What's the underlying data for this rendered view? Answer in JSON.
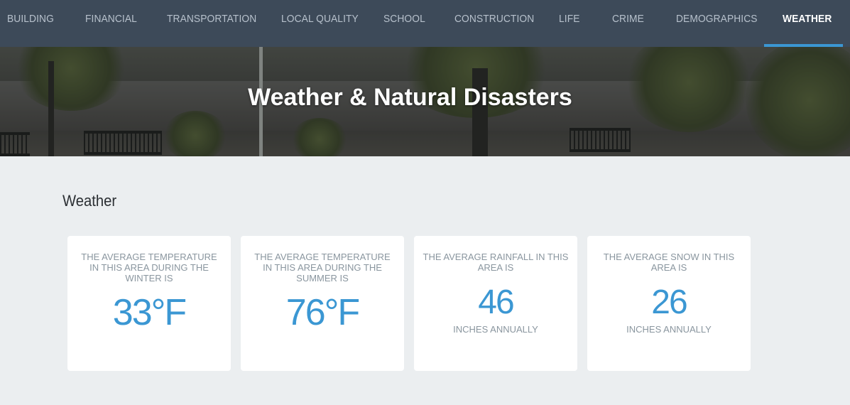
{
  "nav": {
    "items": [
      {
        "label": "BUILDING"
      },
      {
        "label": "FINANCIAL"
      },
      {
        "label": "TRANSPORTATION"
      },
      {
        "label": "LOCAL QUALITY"
      },
      {
        "label": "SCHOOL"
      },
      {
        "label": "CONSTRUCTION"
      },
      {
        "label": "LIFE"
      },
      {
        "label": "CRIME"
      },
      {
        "label": "DEMOGRAPHICS"
      },
      {
        "label": "WEATHER"
      }
    ],
    "active": "WEATHER"
  },
  "hero": {
    "title": "Weather & Natural Disasters"
  },
  "weather": {
    "section_title": "Weather",
    "cards": [
      {
        "label": "THE AVERAGE TEMPERATURE IN THIS AREA DURING THE WINTER IS",
        "value": "33°F",
        "unit": ""
      },
      {
        "label": "THE AVERAGE TEMPERATURE IN THIS AREA DURING THE SUMMER IS",
        "value": "76°F",
        "unit": ""
      },
      {
        "label": "THE AVERAGE RAINFALL IN THIS AREA IS",
        "value": "46",
        "unit": "INCHES ANNUALLY"
      },
      {
        "label": "THE AVERAGE SNOW IN THIS AREA IS",
        "value": "26",
        "unit": "INCHES ANNUALLY"
      }
    ]
  },
  "colors": {
    "nav_bg": "#3d4a59",
    "accent": "#3b97d3",
    "page_bg": "#ebeef0"
  }
}
